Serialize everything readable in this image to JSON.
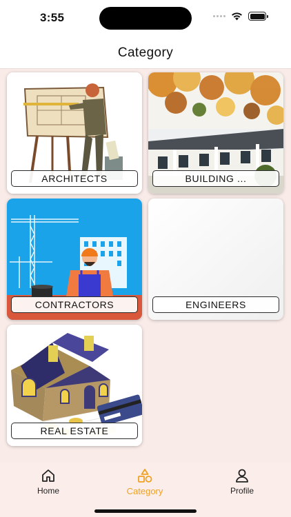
{
  "status": {
    "time": "3:55"
  },
  "header": {
    "title": "Category"
  },
  "categories": [
    {
      "label": "ARCHITECTS"
    },
    {
      "label": "BUILDING ..."
    },
    {
      "label": "CONTRACTORS"
    },
    {
      "label": "ENGINEERS"
    },
    {
      "label": "REAL ESTATE"
    }
  ],
  "tabs": [
    {
      "label": "Home",
      "icon": "home-icon"
    },
    {
      "label": "Category",
      "icon": "shapes-icon",
      "active": true
    },
    {
      "label": "Profile",
      "icon": "person-icon"
    }
  ],
  "colors": {
    "accent": "#f0a020",
    "background": "#f9ebe8"
  }
}
